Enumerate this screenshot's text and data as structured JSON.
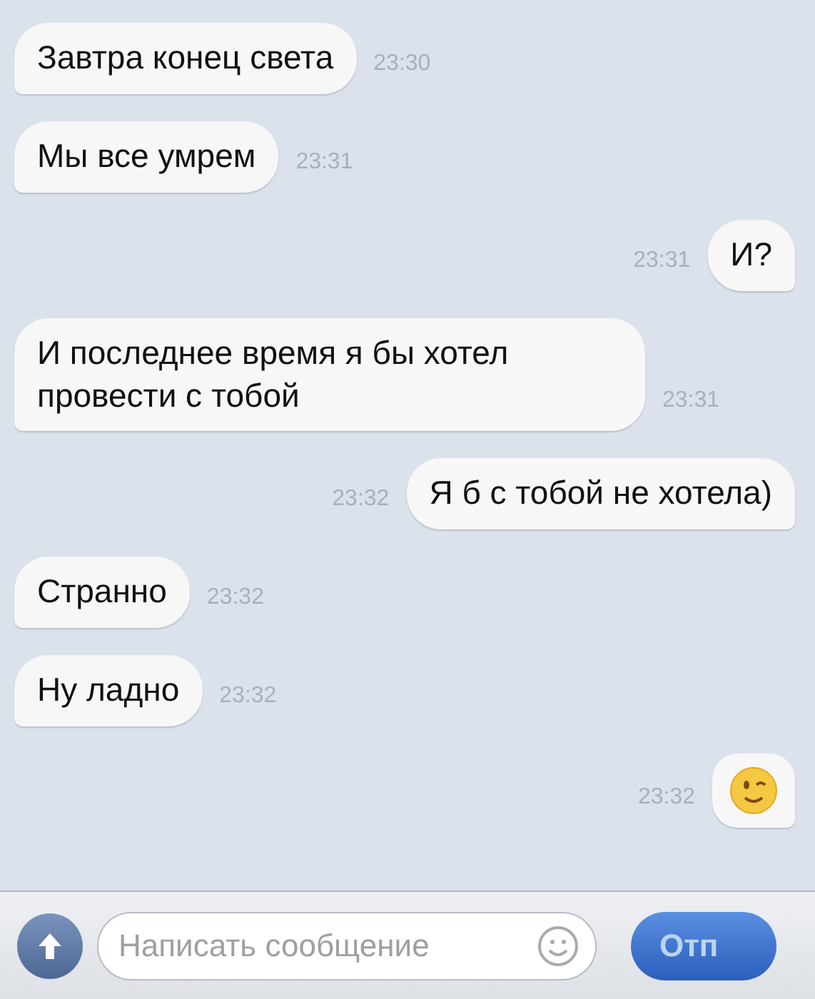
{
  "messages": [
    {
      "outgoing": false,
      "kind": "text",
      "text": "Завтра конец света",
      "time": "23:30"
    },
    {
      "outgoing": false,
      "kind": "text",
      "text": "Мы все умрем",
      "time": "23:31"
    },
    {
      "outgoing": true,
      "kind": "text",
      "text": "И?",
      "time": "23:31"
    },
    {
      "outgoing": false,
      "kind": "text",
      "text": "И последнее время я бы хотел провести с тобой",
      "time": "23:31"
    },
    {
      "outgoing": true,
      "kind": "text",
      "text": "Я б с тобой не хотела)",
      "time": "23:32"
    },
    {
      "outgoing": false,
      "kind": "text",
      "text": "Странно",
      "time": "23:32"
    },
    {
      "outgoing": false,
      "kind": "text",
      "text": "Ну ладно",
      "time": "23:32"
    },
    {
      "outgoing": true,
      "kind": "emoji",
      "time": "23:32"
    }
  ],
  "composer": {
    "placeholder": "Написать сообщение",
    "send_button": "Отп"
  }
}
